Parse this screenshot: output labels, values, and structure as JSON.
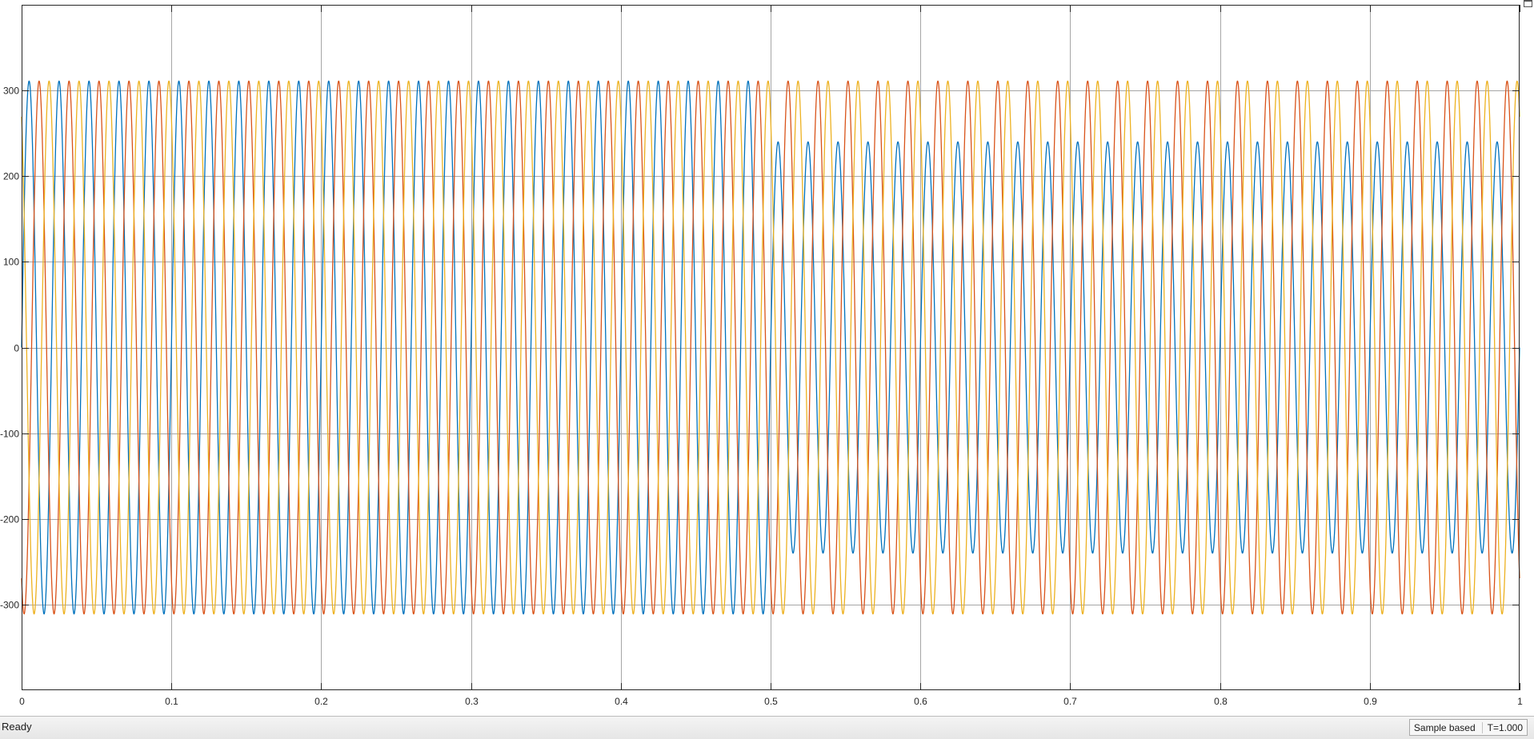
{
  "status_bar": {
    "ready_text": "Ready",
    "sample_mode": "Sample based",
    "time_text": "T=1.000"
  },
  "chart_data": {
    "type": "line",
    "title": "",
    "xlabel": "",
    "ylabel": "",
    "xlim": [
      0,
      1
    ],
    "ylim": [
      -400,
      400
    ],
    "grid": true,
    "legend": "none",
    "xticks": [
      0,
      0.1,
      0.2,
      0.3,
      0.4,
      0.5,
      0.6,
      0.7,
      0.8,
      0.9,
      1
    ],
    "xtick_labels": [
      "0",
      "0.1",
      "0.2",
      "0.3",
      "0.4",
      "0.5",
      "0.6",
      "0.7",
      "0.8",
      "0.9",
      "1"
    ],
    "yticks": [
      300,
      200,
      100,
      0,
      -100,
      -200,
      -300
    ],
    "ytick_labels": [
      "300",
      "200",
      "100",
      "0",
      "-100",
      "-200",
      "-300"
    ],
    "series": [
      {
        "color": "#0072BD",
        "waveform": "sine",
        "frequency_hz": 50,
        "phase_deg": 0,
        "amplitude_segments": [
          {
            "t_start": 0,
            "t_end": 0.5,
            "amplitude": 311
          },
          {
            "t_start": 0.5,
            "t_end": 1,
            "amplitude": 240
          }
        ]
      },
      {
        "color": "#D95319",
        "waveform": "sine",
        "frequency_hz": 50,
        "phase_deg": -120,
        "amplitude_segments": [
          {
            "t_start": 0,
            "t_end": 1,
            "amplitude": 311
          }
        ]
      },
      {
        "color": "#EDB120",
        "waveform": "sine",
        "frequency_hz": 50,
        "phase_deg": 120,
        "amplitude_segments": [
          {
            "t_start": 0,
            "t_end": 1,
            "amplitude": 311
          }
        ]
      }
    ]
  },
  "colors": {
    "axes_border": "#262626",
    "grid": "#a6a6a6"
  }
}
